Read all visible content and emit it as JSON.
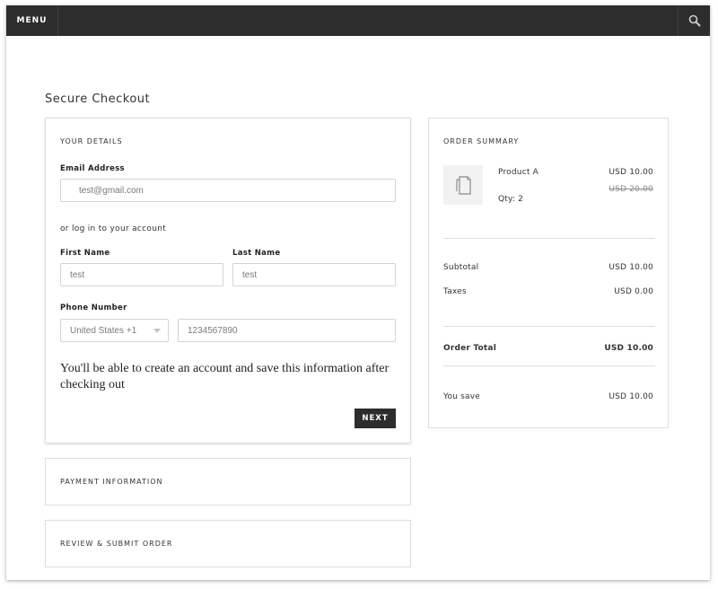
{
  "header": {
    "menu_label": "MENU",
    "search_icon": "search-icon"
  },
  "page": {
    "title": "Secure Checkout"
  },
  "details": {
    "section_title": "YOUR DETAILS",
    "email": {
      "label": "Email Address",
      "value": "test@gmail.com"
    },
    "login_prompt": "or log in to your account",
    "first_name": {
      "label": "First Name",
      "value": "test"
    },
    "last_name": {
      "label": "Last Name",
      "value": "test"
    },
    "phone": {
      "label": "Phone Number",
      "country": "United States +1",
      "number": "1234567890"
    },
    "note": "You'll be able to create an account and save this information after checking out",
    "next_label": "NEXT"
  },
  "payment": {
    "section_title": "PAYMENT INFORMATION"
  },
  "review": {
    "section_title": "REVIEW & SUBMIT ORDER"
  },
  "summary": {
    "section_title": "ORDER SUMMARY",
    "product": {
      "icon": "document-icon",
      "name": "Product A",
      "qty": "Qty: 2",
      "price": "USD 10.00",
      "original_price": "USD 20.00"
    },
    "subtotal": {
      "label": "Subtotal",
      "value": "USD 10.00"
    },
    "taxes": {
      "label": "Taxes",
      "value": "USD 0.00"
    },
    "total": {
      "label": "Order Total",
      "value": "USD 10.00"
    },
    "savings": {
      "label": "You save",
      "value": "USD 10.00"
    }
  }
}
